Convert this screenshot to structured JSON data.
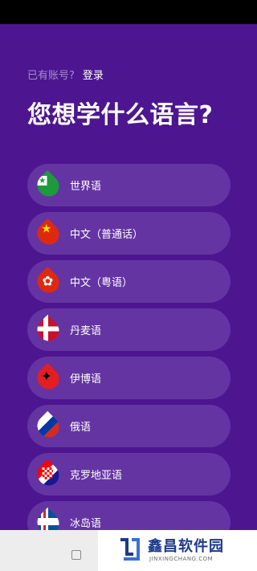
{
  "header": {
    "have_account": "已有账号?",
    "login": "登录",
    "title": "您想学什么语言?"
  },
  "languages": [
    {
      "label": "世界语",
      "flag": "esperanto-flag-icon"
    },
    {
      "label": "中文（普通话）",
      "flag": "china-flag-icon"
    },
    {
      "label": "中文（粤语）",
      "flag": "hong-kong-flag-icon"
    },
    {
      "label": "丹麦语",
      "flag": "denmark-flag-icon"
    },
    {
      "label": "伊博语",
      "flag": "igbo-flag-icon"
    },
    {
      "label": "俄语",
      "flag": "russia-flag-icon"
    },
    {
      "label": "克罗地亚语",
      "flag": "croatia-flag-icon"
    },
    {
      "label": "冰岛语",
      "flag": "iceland-flag-icon"
    }
  ],
  "watermark": {
    "title": "鑫昌软件园",
    "subtitle": "JINXINGCHANG.COM"
  },
  "colors": {
    "background": "#4d1690",
    "item_background": "#6534a3",
    "muted_text": "#a68ccf"
  }
}
